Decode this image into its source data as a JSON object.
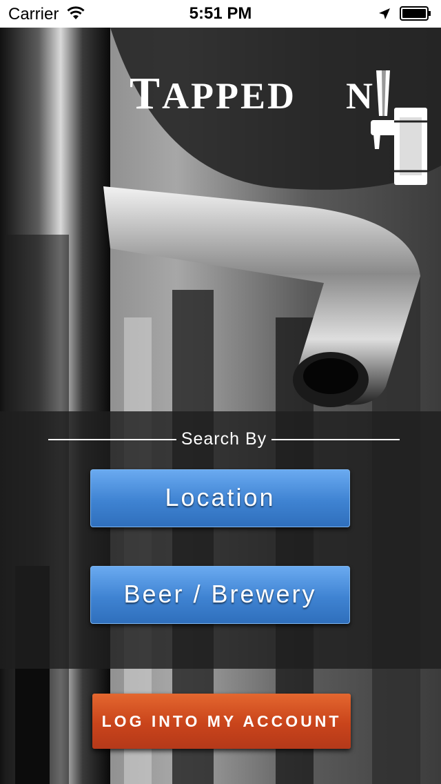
{
  "status_bar": {
    "carrier": "Carrier",
    "time": "5:51 PM"
  },
  "logo": {
    "first_word_initial": "T",
    "first_word_rest": "APPED",
    "second_word_rest": "N"
  },
  "search": {
    "heading": "Search By",
    "location_label": "Location",
    "beer_label": "Beer / Brewery"
  },
  "account": {
    "login_label": "LOG INTO MY ACCOUNT"
  },
  "colors": {
    "blue_button": "#3f83d2",
    "orange_button": "#c9441b",
    "panel": "#1e1e1e"
  },
  "icons": {
    "wifi": "wifi-icon",
    "location": "location-arrow-icon",
    "battery": "battery-icon",
    "tap": "beer-tap-icon"
  }
}
